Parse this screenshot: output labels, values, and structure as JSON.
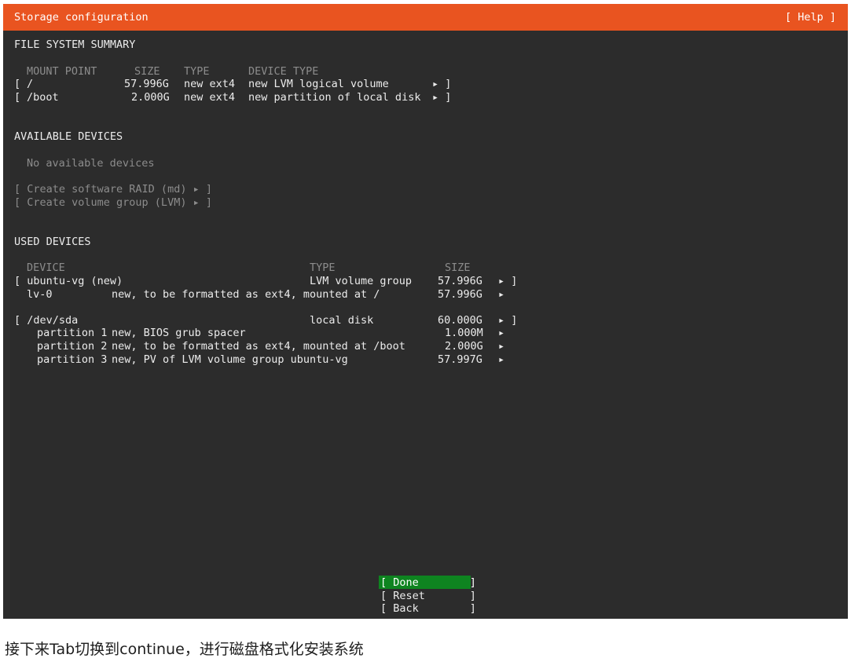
{
  "window": {
    "title": "Storage configuration",
    "help_label": "[ Help ]"
  },
  "fs_summary": {
    "heading": "FILE SYSTEM SUMMARY",
    "columns": {
      "mount_point": "MOUNT POINT",
      "size": "SIZE",
      "type": "TYPE",
      "device_type": "DEVICE TYPE"
    },
    "rows": [
      {
        "bracket": "[",
        "mount": "/",
        "size": "57.996G",
        "type": "new ext4",
        "device_type": "new LVM logical volume",
        "arrow": "▸ ]"
      },
      {
        "bracket": "[",
        "mount": "/boot",
        "size": "2.000G",
        "type": "new ext4",
        "device_type": "new partition of local disk",
        "arrow": "▸ ]"
      }
    ]
  },
  "available_devices": {
    "heading": "AVAILABLE DEVICES",
    "empty_text": "No available devices",
    "actions": [
      "[ Create software RAID (md) ▸ ]",
      "[ Create volume group (LVM) ▸ ]"
    ]
  },
  "used_devices": {
    "heading": "USED DEVICES",
    "columns": {
      "device": "DEVICE",
      "type": "TYPE",
      "size": "SIZE"
    },
    "groups": [
      {
        "header": {
          "label": "[ ubuntu-vg (new)",
          "type": "LVM volume group",
          "size": "57.996G",
          "arrow": "▸ ]"
        },
        "children": [
          {
            "name": "lv-0",
            "desc": "new, to be formatted as ext4, mounted at /",
            "size": "57.996G",
            "arrow": "▸"
          }
        ]
      },
      {
        "header": {
          "label": "[ /dev/sda",
          "type": "local disk",
          "size": "60.000G",
          "arrow": "▸ ]"
        },
        "children": [
          {
            "name": "partition 1",
            "desc": "new, BIOS grub spacer",
            "size": "1.000M",
            "arrow": "▸"
          },
          {
            "name": "partition 2",
            "desc": "new, to be formatted as ext4, mounted at /boot",
            "size": "2.000G",
            "arrow": "▸"
          },
          {
            "name": "partition 3",
            "desc": "new, PV of LVM volume group ubuntu-vg",
            "size": "57.997G",
            "arrow": "▸"
          }
        ]
      }
    ]
  },
  "buttons": {
    "done": "[ Done        ]",
    "reset": "[ Reset       ]",
    "back": "[ Back        ]"
  },
  "colors": {
    "title_bar": "#e95420",
    "background": "#2c2c2c",
    "focused_button": "#0e8420"
  },
  "caption": "接下来Tab切换到continue，进行磁盘格式化安装系统"
}
